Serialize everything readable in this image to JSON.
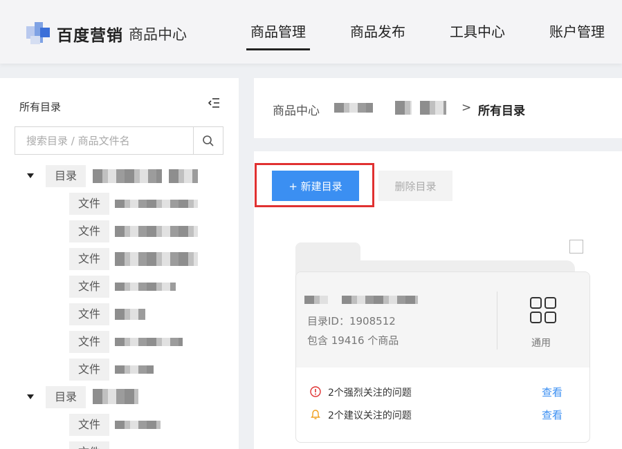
{
  "header": {
    "brand": "百度营销",
    "subtitle": "商品中心",
    "nav": [
      {
        "label": "商品管理",
        "active": true
      },
      {
        "label": "商品发布",
        "active": false
      },
      {
        "label": "工具中心",
        "active": false
      },
      {
        "label": "账户管理",
        "active": false
      }
    ]
  },
  "sidebar": {
    "title": "所有目录",
    "search_placeholder": "搜索目录 / 商品文件名",
    "dir_tag": "目录",
    "file_tag": "文件"
  },
  "breadcrumb": {
    "root": "商品中心",
    "separator": ">",
    "current": "所有目录"
  },
  "toolbar": {
    "new_label": "+ 新建目录",
    "delete_label": "删除目录"
  },
  "card": {
    "id_text": "目录ID：1908512",
    "count_text": "包含 19416 个商品",
    "type_label": "通用",
    "issues": [
      {
        "text": "2个强烈关注的问题",
        "link": "查看",
        "icon": "alert-circle-icon",
        "color": "#e03131"
      },
      {
        "text": "2个建议关注的问题",
        "link": "查看",
        "icon": "bell-icon",
        "color": "#f0a020"
      }
    ]
  },
  "colors": {
    "accent": "#3b8ff2",
    "highlight": "#e03131"
  }
}
